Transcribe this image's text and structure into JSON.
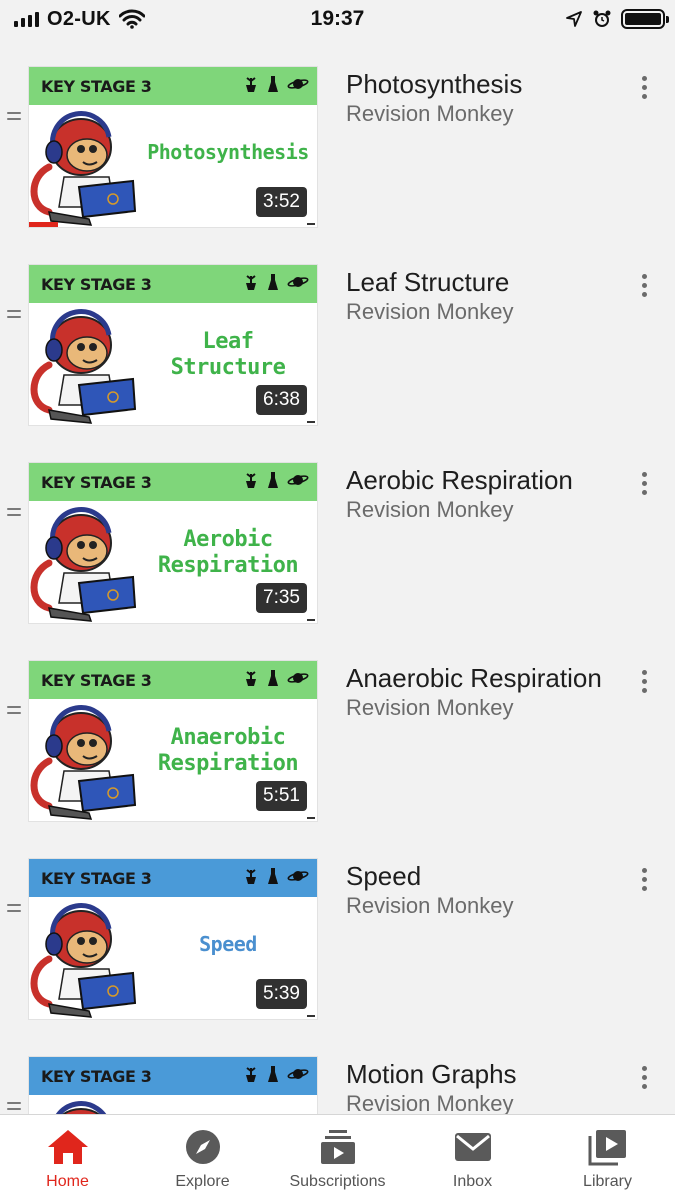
{
  "status_bar": {
    "carrier": "O2-UK",
    "time": "19:37",
    "icons": [
      "signal-icon",
      "wifi-icon",
      "location-arrow-icon",
      "alarm-icon",
      "battery-icon"
    ]
  },
  "thumbnail_banner": "KEY STAGE 3",
  "colors": {
    "green_banner": "#7fd67a",
    "green_text": "#3fb34a",
    "blue_banner": "#4a9ad8",
    "blue_text": "#4a8fcf",
    "accent": "#e0261c"
  },
  "videos": [
    {
      "title": "Photosynthesis",
      "channel": "Revision Monkey",
      "thumb_lines": [
        "Photosynthesis"
      ],
      "duration": "3:52",
      "theme": "green",
      "watched_fraction": 0.1
    },
    {
      "title": "Leaf Structure",
      "channel": "Revision Monkey",
      "thumb_lines": [
        "Leaf",
        "Structure"
      ],
      "duration": "6:38",
      "theme": "green",
      "watched_fraction": 0
    },
    {
      "title": "Aerobic Respiration",
      "channel": "Revision Monkey",
      "thumb_lines": [
        "Aerobic",
        "Respiration"
      ],
      "duration": "7:35",
      "theme": "green",
      "watched_fraction": 0
    },
    {
      "title": "Anaerobic Respiration",
      "channel": "Revision Monkey",
      "thumb_lines": [
        "Anaerobic",
        "Respiration"
      ],
      "duration": "5:51",
      "theme": "green",
      "watched_fraction": 0
    },
    {
      "title": "Speed",
      "channel": "Revision Monkey",
      "thumb_lines": [
        "Speed"
      ],
      "duration": "5:39",
      "theme": "blue",
      "watched_fraction": 0
    },
    {
      "title": "Motion Graphs",
      "channel": "Revision Monkey",
      "thumb_lines": [],
      "duration": "",
      "theme": "blue",
      "watched_fraction": 0
    }
  ],
  "tab_bar": {
    "tabs": [
      {
        "label": "Home",
        "icon": "home-icon",
        "active": true
      },
      {
        "label": "Explore",
        "icon": "compass-icon",
        "active": false
      },
      {
        "label": "Subscriptions",
        "icon": "subscriptions-icon",
        "active": false
      },
      {
        "label": "Inbox",
        "icon": "inbox-icon",
        "active": false
      },
      {
        "label": "Library",
        "icon": "library-icon",
        "active": false
      }
    ]
  }
}
